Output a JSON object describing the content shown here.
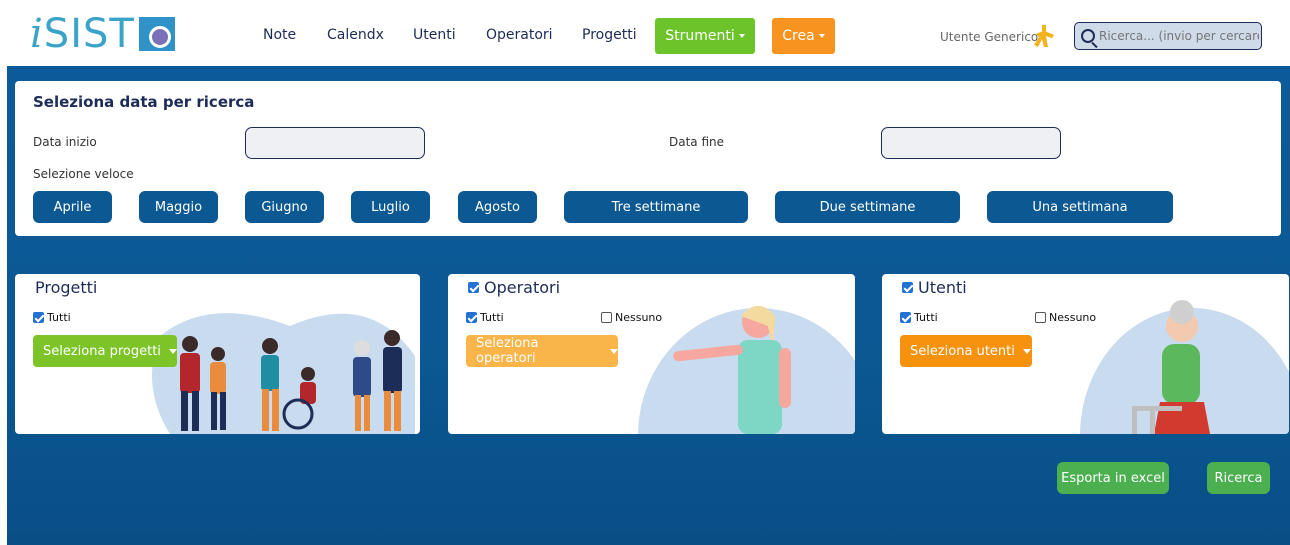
{
  "header": {
    "logo_text": "SIST",
    "logo_prefix": "i",
    "nav": [
      {
        "label": "Note"
      },
      {
        "label": "Calendx"
      },
      {
        "label": "Utenti"
      },
      {
        "label": "Operatori"
      },
      {
        "label": "Progetti"
      }
    ],
    "strumenti_label": "Strumenti",
    "crea_label": "Crea",
    "user_name": "Utente Generico",
    "search_placeholder": "Ricerca... (invio per cercare)",
    "colors": {
      "strumenti": "#6cc42a",
      "crea": "#f7931e"
    }
  },
  "date_search": {
    "title": "Seleziona data per ricerca",
    "start_label": "Data inizio",
    "end_label": "Data fine",
    "start_value": "",
    "end_value": "",
    "quick_label": "Selezione veloce",
    "quick_buttons": [
      "Aprile",
      "Maggio",
      "Giugno",
      "Luglio",
      "Agosto",
      "Tre settimane",
      "Due settimane",
      "Una settimana"
    ]
  },
  "projects": {
    "title": "Progetti",
    "all_label": "Tutti",
    "select_label": "Seleziona progetti",
    "color": "#7cc427"
  },
  "operators": {
    "title": "Operatori",
    "all_label": "Tutti",
    "none_label": "Nessuno",
    "select_label": "Seleziona operatori",
    "color": "#f9b54a"
  },
  "users": {
    "title": "Utenti",
    "all_label": "Tutti",
    "none_label": "Nessuno",
    "select_label": "Seleziona utenti",
    "color": "#f7920e"
  },
  "actions": {
    "export_label": "Esporta in excel",
    "search_label": "Ricerca"
  }
}
